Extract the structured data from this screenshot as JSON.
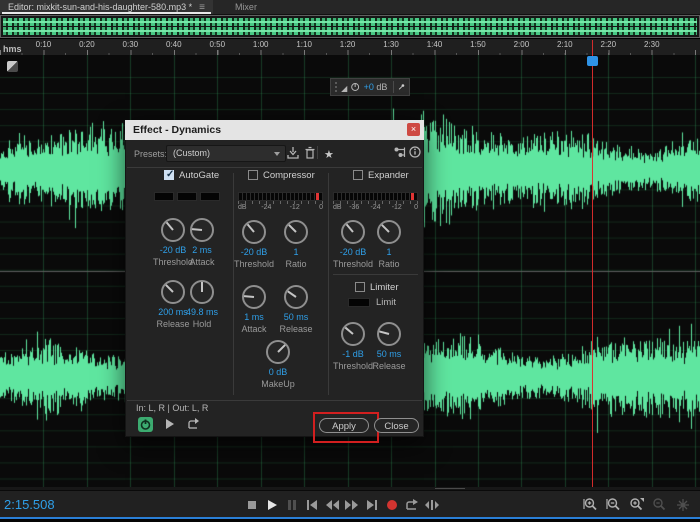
{
  "tabs": {
    "editor_label": "Editor: mixkit-sun-and-his-daughter-580.mp3 *",
    "mixer_label": "Mixer"
  },
  "ruler": {
    "unit_label": "hms",
    "tick_labels": [
      "0:10",
      "0:20",
      "0:30",
      "0:40",
      "0:50",
      "1:00",
      "1:10",
      "1:20",
      "1:30",
      "1:40",
      "1:50",
      "2:00",
      "2:10",
      "2:20",
      "2:30"
    ]
  },
  "hud": {
    "gain_value": "+0",
    "gain_unit": "dB"
  },
  "dialog": {
    "title": "Effect - Dynamics",
    "presets_label": "Presets:",
    "preset_value": "(Custom)",
    "autogate": {
      "title": "AutoGate",
      "checked": true,
      "knobs": [
        {
          "value": "-20 dB",
          "label": "Threshold",
          "angle": -40
        },
        {
          "value": "2 ms",
          "label": "Attack",
          "angle": -85
        },
        {
          "value": "200 ms",
          "label": "Release",
          "angle": -45
        },
        {
          "value": "49.8 ms",
          "label": "Hold",
          "angle": 0
        }
      ]
    },
    "compressor": {
      "title": "Compressor",
      "checked": false,
      "meter_scale": [
        "dB",
        "-24",
        "-12",
        "0"
      ],
      "knobs": [
        {
          "value": "-20 dB",
          "label": "Threshold",
          "angle": -40
        },
        {
          "value": "1",
          "label": "Ratio",
          "angle": -45
        },
        {
          "value": "1 ms",
          "label": "Attack",
          "angle": -85
        },
        {
          "value": "50 ms",
          "label": "Release",
          "angle": -55
        }
      ],
      "makeup_knob": {
        "value": "0 dB",
        "label": "MakeUp",
        "angle": 45
      }
    },
    "expander": {
      "title": "Expander",
      "checked": false,
      "meter_scale": [
        "dB",
        "-36",
        "-24",
        "-12",
        "0"
      ],
      "knobs": [
        {
          "value": "-20 dB",
          "label": "Threshold",
          "angle": -40
        },
        {
          "value": "1",
          "label": "Ratio",
          "angle": -45
        }
      ]
    },
    "limiter": {
      "title": "Limiter",
      "checked": false,
      "limit_label": "Limit",
      "knobs": [
        {
          "value": "-1 dB",
          "label": "Threshold",
          "angle": -50
        },
        {
          "value": "50 ms",
          "label": "Release",
          "angle": -75
        }
      ]
    },
    "io_text": "In: L, R | Out: L, R",
    "apply_label": "Apply",
    "close_label": "Close"
  },
  "transport": {
    "buttons": [
      {
        "name": "stop",
        "dim": false
      },
      {
        "name": "play",
        "dim": false,
        "bright": true
      },
      {
        "name": "pause",
        "dim": true
      },
      {
        "name": "skip-to-start",
        "dim": false
      },
      {
        "name": "rewind",
        "dim": false
      },
      {
        "name": "fast-forward",
        "dim": false
      },
      {
        "name": "skip-to-end",
        "dim": false
      },
      {
        "name": "record",
        "dim": false,
        "red": true
      },
      {
        "name": "loop-playback",
        "dim": false
      },
      {
        "name": "move-playhead",
        "dim": false
      }
    ]
  },
  "zoom_tools": [
    {
      "name": "zoom-in",
      "dim": false
    },
    {
      "name": "zoom-out",
      "dim": false
    },
    {
      "name": "zoom-in-selection",
      "dim": false
    },
    {
      "name": "zoom-out-full",
      "dim": true
    },
    {
      "name": "zoom-reset",
      "dim": true
    }
  ],
  "status": {
    "time": "2:15.508"
  },
  "colors": {
    "waveform": "#5fe6a0",
    "grid": "rgba(60,190,110,0.18)",
    "grid_vertical": "rgba(60,190,110,0.28)",
    "playhead": "#d22f2f",
    "value_blue": "#2f9fe8",
    "annotation": "#d21f1f"
  }
}
